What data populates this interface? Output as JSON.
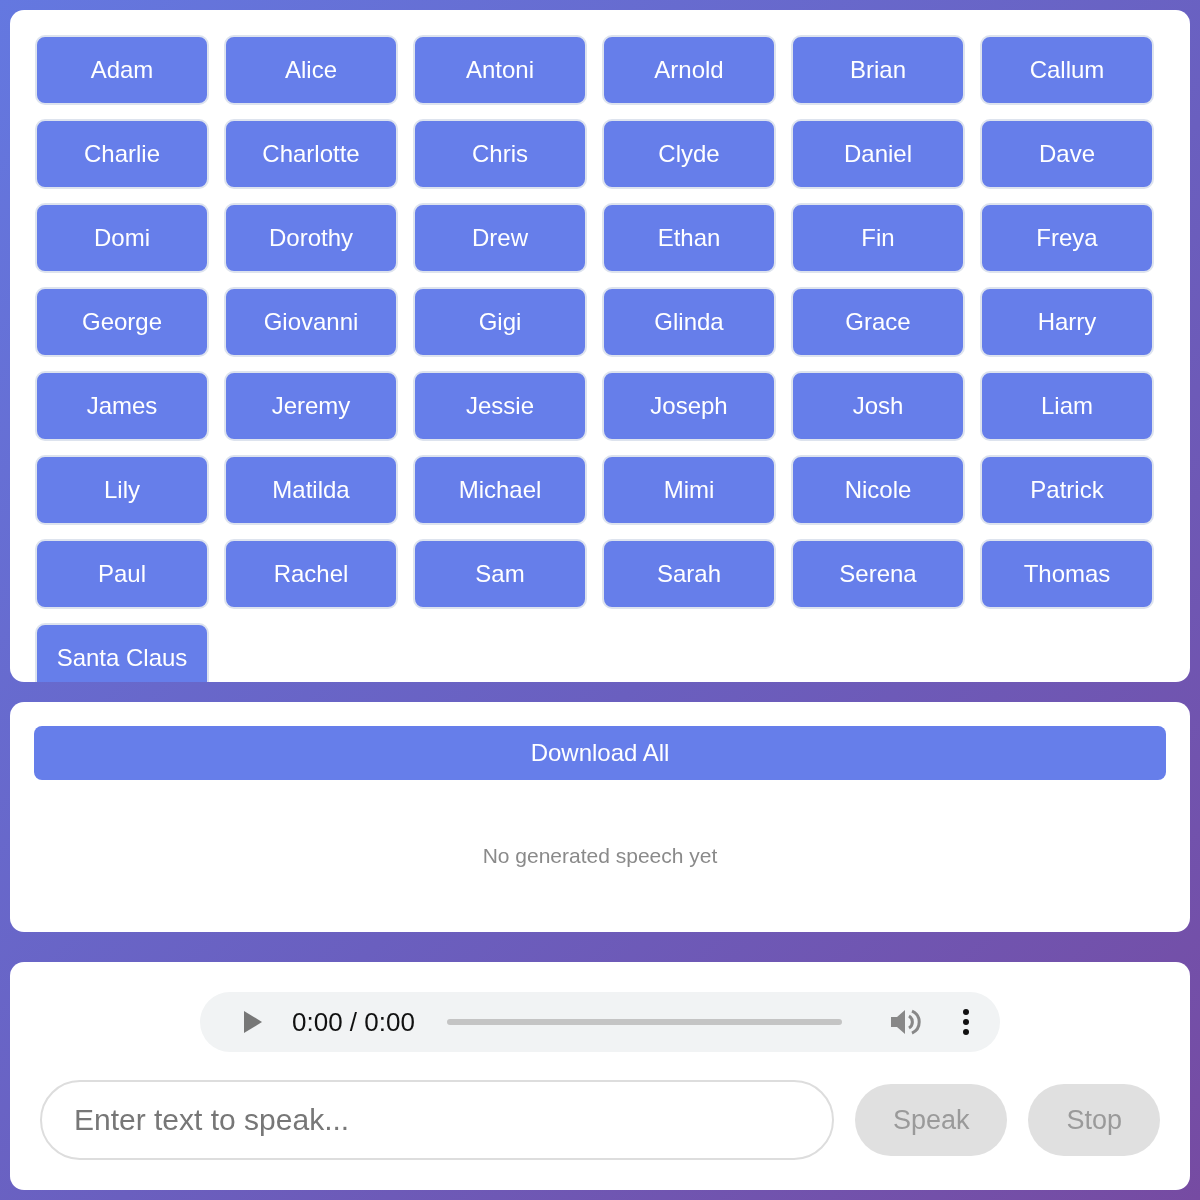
{
  "voices": [
    {
      "label": "Adam"
    },
    {
      "label": "Alice"
    },
    {
      "label": "Antoni"
    },
    {
      "label": "Arnold"
    },
    {
      "label": "Brian"
    },
    {
      "label": "Callum"
    },
    {
      "label": "Charlie"
    },
    {
      "label": "Charlotte"
    },
    {
      "label": "Chris"
    },
    {
      "label": "Clyde"
    },
    {
      "label": "Daniel"
    },
    {
      "label": "Dave"
    },
    {
      "label": "Domi"
    },
    {
      "label": "Dorothy"
    },
    {
      "label": "Drew"
    },
    {
      "label": "Ethan"
    },
    {
      "label": "Fin"
    },
    {
      "label": "Freya"
    },
    {
      "label": "George"
    },
    {
      "label": "Giovanni"
    },
    {
      "label": "Gigi"
    },
    {
      "label": "Glinda"
    },
    {
      "label": "Grace"
    },
    {
      "label": "Harry"
    },
    {
      "label": "James"
    },
    {
      "label": "Jeremy"
    },
    {
      "label": "Jessie"
    },
    {
      "label": "Joseph"
    },
    {
      "label": "Josh"
    },
    {
      "label": "Liam"
    },
    {
      "label": "Lily"
    },
    {
      "label": "Matilda"
    },
    {
      "label": "Michael"
    },
    {
      "label": "Mimi"
    },
    {
      "label": "Nicole"
    },
    {
      "label": "Patrick"
    },
    {
      "label": "Paul"
    },
    {
      "label": "Rachel"
    },
    {
      "label": "Sam"
    },
    {
      "label": "Sarah"
    },
    {
      "label": "Serena"
    },
    {
      "label": "Thomas"
    },
    {
      "label": "Santa Claus"
    }
  ],
  "downloads": {
    "button": "Download All",
    "empty_message": "No generated speech yet"
  },
  "player": {
    "time": "0:00 / 0:00"
  },
  "input": {
    "placeholder": "Enter text to speak..."
  },
  "buttons": [
    {
      "label": "Speak",
      "disabled": true
    },
    {
      "label": "Stop",
      "disabled": true
    }
  ]
}
